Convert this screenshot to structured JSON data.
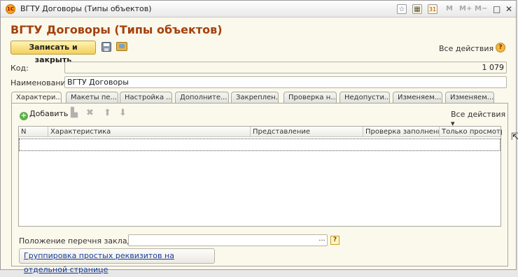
{
  "window": {
    "logo_text": "1С",
    "title": "ВГТУ Договоры (Типы объектов)",
    "title_buttons": [
      "M",
      "M+",
      "M−"
    ],
    "controls": [
      "□",
      "✕"
    ]
  },
  "form": {
    "heading": "ВГТУ Договоры (Типы объектов)",
    "save_close_label": "Записать и закрыть",
    "all_actions_label": "Все действия ▾",
    "help_label": "?"
  },
  "fields": {
    "code_label": "Код:",
    "code_value": "1 079",
    "name_label": "Наименование:",
    "name_value": "ВГТУ Договоры"
  },
  "tabs": [
    {
      "label": "Характери..."
    },
    {
      "label": "Макеты пе..."
    },
    {
      "label": "Настройка ..."
    },
    {
      "label": "Дополните..."
    },
    {
      "label": "Закреплен..."
    },
    {
      "label": "Проверка н..."
    },
    {
      "label": "Недопусти..."
    },
    {
      "label": "Изменяем..."
    },
    {
      "label": "Изменяем..."
    }
  ],
  "tab_panel": {
    "add_label": "Добавить",
    "all_actions_label": "Все действия ▾",
    "columns": [
      "N",
      "Характеристика",
      "Представление",
      "Проверка заполнения",
      "Только просмотр"
    ],
    "position_label": "Положение перечня закладок:",
    "position_value": "",
    "dots_label": "...",
    "question_label": "?",
    "group_button_label": "Группировка простых реквизитов на отдельной странице"
  },
  "colors": {
    "form_background": "#fbf8ec",
    "heading": "#a4410d",
    "primary_button": "#f4cf5c",
    "link": "#1b3f99"
  }
}
